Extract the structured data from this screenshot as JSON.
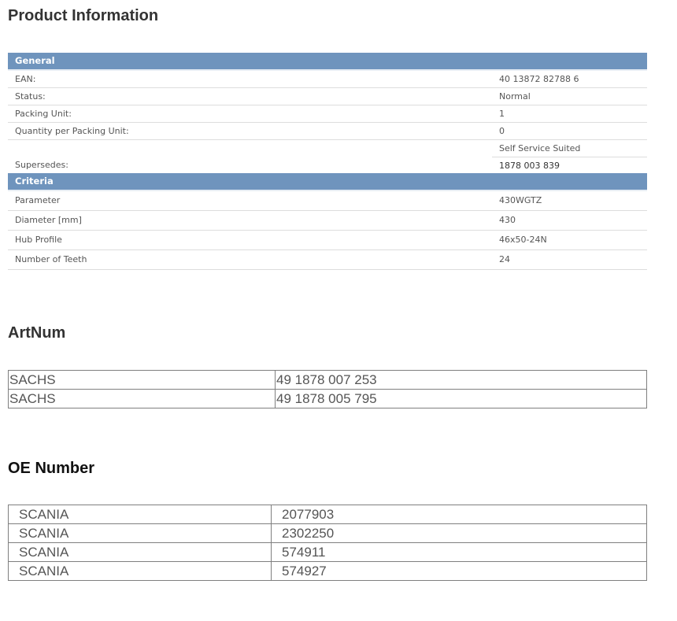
{
  "product_information": {
    "title": "Product Information",
    "general": {
      "header": "General",
      "rows": [
        {
          "label": "EAN:",
          "value": "40 13872 82788 6"
        },
        {
          "label": "Status:",
          "value": "Normal"
        },
        {
          "label": "Packing Unit:",
          "value": "1"
        },
        {
          "label": "Quantity per Packing Unit:",
          "value": "0"
        }
      ],
      "self_service": "Self Service Suited",
      "supersedes": {
        "label": "Supersedes:",
        "value": "1878 003 839"
      }
    },
    "criteria": {
      "header": "Criteria",
      "rows": [
        {
          "label": "Parameter",
          "value": "430WGTZ"
        },
        {
          "label": "Diameter [mm]",
          "value": "430"
        },
        {
          "label": "Hub Profile",
          "value": "46x50-24N"
        },
        {
          "label": "Number of Teeth",
          "value": "24"
        }
      ]
    }
  },
  "artnum": {
    "title": "ArtNum",
    "rows": [
      {
        "brand": "SACHS",
        "number": "49 1878 007 253"
      },
      {
        "brand": "SACHS",
        "number": "49 1878 005 795"
      }
    ]
  },
  "oe_number": {
    "title": "OE Number",
    "rows": [
      {
        "brand": "SCANIA",
        "number": "2077903"
      },
      {
        "brand": "SCANIA",
        "number": "2302250"
      },
      {
        "brand": "SCANIA",
        "number": "574911"
      },
      {
        "brand": "SCANIA",
        "number": "574927"
      }
    ]
  }
}
